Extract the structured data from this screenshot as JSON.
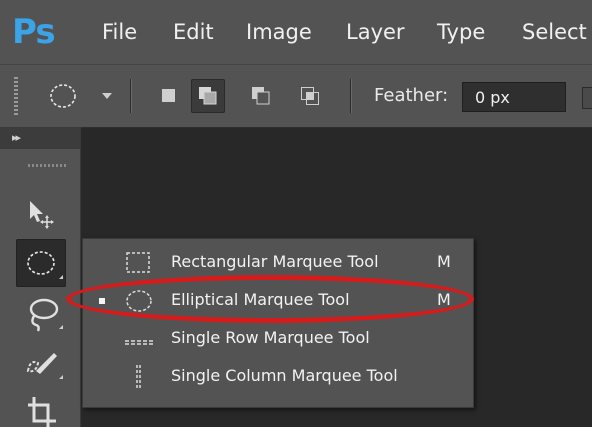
{
  "app": {
    "logo": "Ps"
  },
  "menubar": {
    "items": [
      {
        "label": "File"
      },
      {
        "label": "Edit"
      },
      {
        "label": "Image"
      },
      {
        "label": "Layer"
      },
      {
        "label": "Type"
      },
      {
        "label": "Select"
      }
    ]
  },
  "options_bar": {
    "tool_preset_icon": "elliptical-marquee-icon",
    "selection_modes": [
      {
        "icon": "new-selection-icon",
        "active": false
      },
      {
        "icon": "add-to-selection-icon",
        "active": true
      },
      {
        "icon": "subtract-from-selection-icon",
        "active": false
      },
      {
        "icon": "intersect-selection-icon",
        "active": false
      }
    ],
    "feather": {
      "label": "Feather:",
      "value": "0 px"
    }
  },
  "tools_panel": {
    "tools": [
      {
        "icon": "move-tool-icon"
      },
      {
        "icon": "elliptical-marquee-tool-icon",
        "active": true
      },
      {
        "icon": "lasso-tool-icon"
      },
      {
        "icon": "quick-selection-tool-icon"
      },
      {
        "icon": "crop-tool-icon"
      }
    ]
  },
  "flyout": {
    "items": [
      {
        "label": "Rectangular Marquee Tool",
        "shortcut": "M",
        "icon": "rectangular-marquee-icon",
        "selected": false
      },
      {
        "label": "Elliptical Marquee Tool",
        "shortcut": "M",
        "icon": "elliptical-marquee-icon",
        "selected": true
      },
      {
        "label": "Single Row Marquee Tool",
        "shortcut": "",
        "icon": "single-row-marquee-icon",
        "selected": false
      },
      {
        "label": "Single Column Marquee Tool",
        "shortcut": "",
        "icon": "single-column-marquee-icon",
        "selected": false
      }
    ]
  },
  "colors": {
    "panel": "#535353",
    "canvas": "#282828",
    "logo": "#3ba4e8",
    "highlight_ring": "#d41c1c"
  }
}
